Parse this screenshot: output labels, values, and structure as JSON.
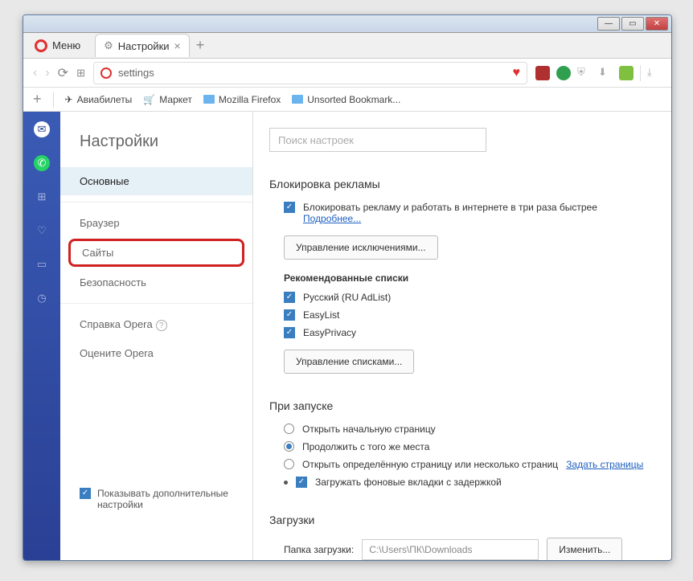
{
  "app": {
    "menu_label": "Меню"
  },
  "tab": {
    "title": "Настройки"
  },
  "address": {
    "text": "settings"
  },
  "bookmarks": {
    "b1": "Авиабилеты",
    "b2": "Маркет",
    "b3": "Mozilla Firefox",
    "b4": "Unsorted Bookmark..."
  },
  "settings": {
    "title": "Настройки",
    "nav": {
      "main": "Основные",
      "browser": "Браузер",
      "sites": "Сайты",
      "security": "Безопасность",
      "help": "Справка Opera",
      "rate": "Оцените Opera"
    },
    "show_adv": "Показывать дополнительные настройки",
    "search_placeholder": "Поиск настроек"
  },
  "ads": {
    "heading": "Блокировка рекламы",
    "block_label": "Блокировать рекламу и работать в интернете в три раза быстрее",
    "more": "Подробнее...",
    "manage_exc": "Управление исключениями...",
    "reco_heading": "Рекомендованные списки",
    "list1": "Русский (RU AdList)",
    "list2": "EasyList",
    "list3": "EasyPrivacy",
    "manage_lists": "Управление списками..."
  },
  "startup": {
    "heading": "При запуске",
    "opt1": "Открыть начальную страницу",
    "opt2": "Продолжить с того же места",
    "opt3": "Открыть определённую страницу или несколько страниц",
    "set_pages": "Задать страницы",
    "bg_tabs": "Загружать фоновые вкладки с задержкой"
  },
  "downloads": {
    "heading": "Загрузки",
    "folder_label": "Папка загрузки:",
    "folder_value": "C:\\Users\\ПК\\Downloads",
    "change": "Изменить..."
  }
}
